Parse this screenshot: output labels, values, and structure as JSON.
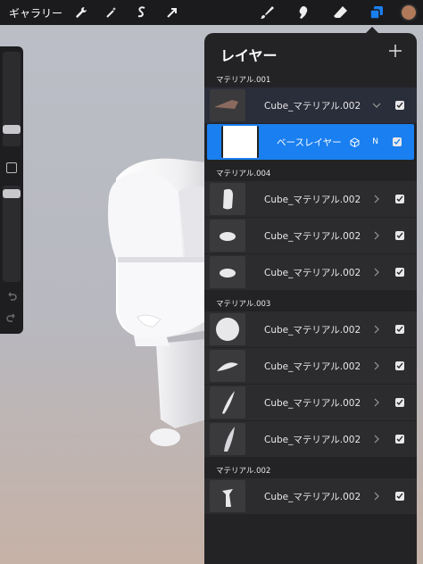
{
  "toolbar": {
    "gallery_label": "ギャラリー",
    "left_tools": [
      "wrench-icon",
      "magic-wand-icon",
      "selection-icon",
      "transform-arrow-icon"
    ],
    "right_tools": [
      "brush-icon",
      "smudge-icon",
      "eraser-icon",
      "layers-icon"
    ],
    "active_tool": "layers-icon",
    "color": "#b07a5a"
  },
  "panel": {
    "title": "レイヤー",
    "add_label": "+",
    "groups": [
      {
        "label": "マテリアル.001",
        "rows": [
          {
            "label": "Cube_マテリアル.002",
            "state": "expanded"
          },
          {
            "label": "ベースレイヤー",
            "state": "selected",
            "blend": "N"
          }
        ]
      },
      {
        "label": "マテリアル.004",
        "rows": [
          {
            "label": "Cube_マテリアル.002"
          },
          {
            "label": "Cube_マテリアル.002"
          },
          {
            "label": "Cube_マテリアル.002"
          }
        ]
      },
      {
        "label": "マテリアル.003",
        "rows": [
          {
            "label": "Cube_マテリアル.002"
          },
          {
            "label": "Cube_マテリアル.002"
          },
          {
            "label": "Cube_マテリアル.002"
          },
          {
            "label": "Cube_マテリアル.002"
          }
        ]
      },
      {
        "label": "マテリアル.002",
        "rows": [
          {
            "label": "Cube_マテリアル.002"
          }
        ]
      }
    ]
  },
  "colors": {
    "accent": "#1a7ff0",
    "panel_bg": "#232325",
    "row_bg": "#2c2c2e"
  }
}
